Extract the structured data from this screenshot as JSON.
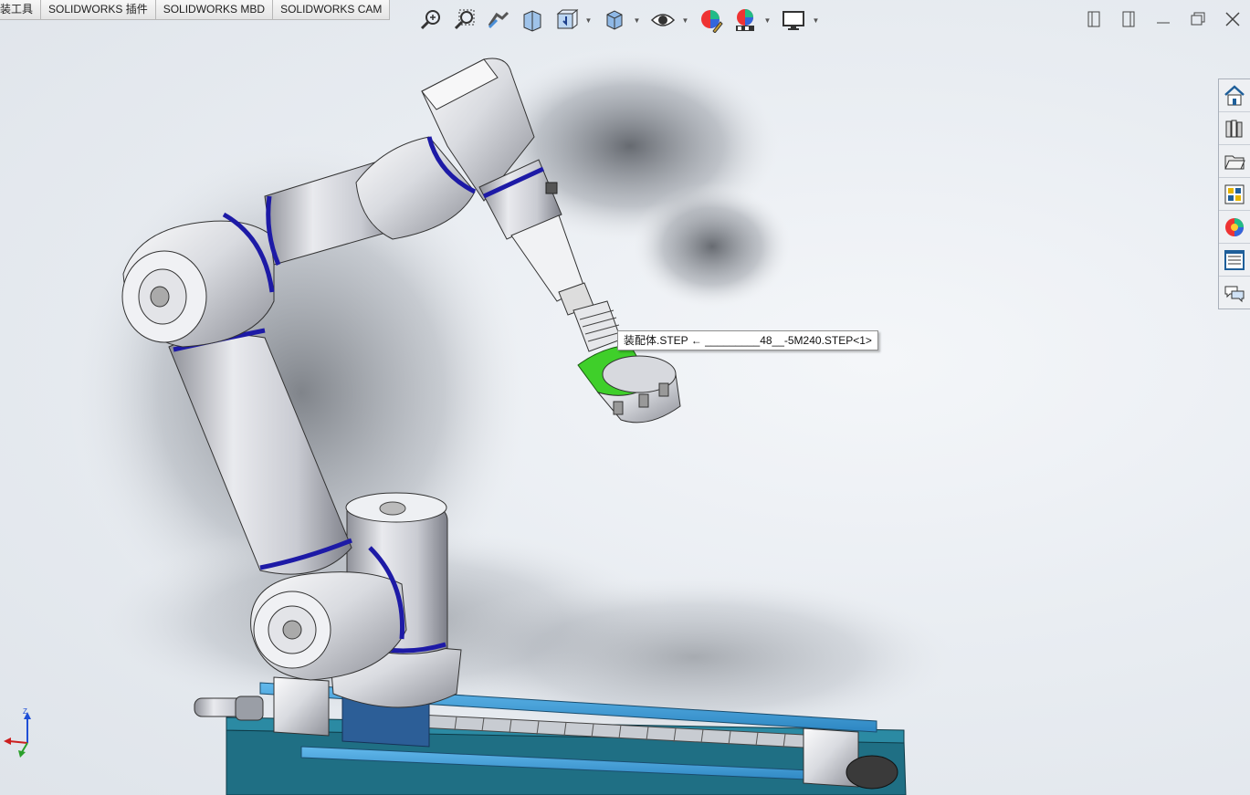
{
  "tabs": [
    {
      "label": "装工具"
    },
    {
      "label": "SOLIDWORKS 插件"
    },
    {
      "label": "SOLIDWORKS MBD"
    },
    {
      "label": "SOLIDWORKS CAM"
    }
  ],
  "view_toolbar": {
    "buttons": [
      {
        "icon": "zoom-to-fit-icon"
      },
      {
        "icon": "zoom-to-area-icon"
      },
      {
        "icon": "previous-view-icon"
      },
      {
        "icon": "section-view-icon"
      },
      {
        "icon": "view-orientation-icon"
      },
      {
        "icon": "display-style-icon"
      },
      {
        "icon": "hide-show-items-icon"
      },
      {
        "icon": "edit-appearance-icon"
      },
      {
        "icon": "apply-scene-icon"
      },
      {
        "icon": "view-settings-icon"
      }
    ]
  },
  "window_controls": [
    "tile-left-icon",
    "tile-right-icon",
    "minimize-icon",
    "restore-icon",
    "close-icon"
  ],
  "task_pane": [
    "solidworks-resources-icon",
    "design-library-icon",
    "file-explorer-icon",
    "view-palette-icon",
    "appearances-scenes-icon",
    "custom-properties-icon",
    "forum-icon"
  ],
  "tooltip": {
    "text": "装配体.STEP ← _________48__-5M240.STEP<1>"
  },
  "triad": {
    "z_label": "Z",
    "colors": {
      "x": "#cc1f1f",
      "y": "#2aa02a",
      "z": "#1f4fd6"
    }
  },
  "colors": {
    "accent_band": "#1d1aa6",
    "gripper_green": "#3fcf2a",
    "rail_teal": "#1e6f86",
    "rail_blue": "#4aa8e0"
  }
}
